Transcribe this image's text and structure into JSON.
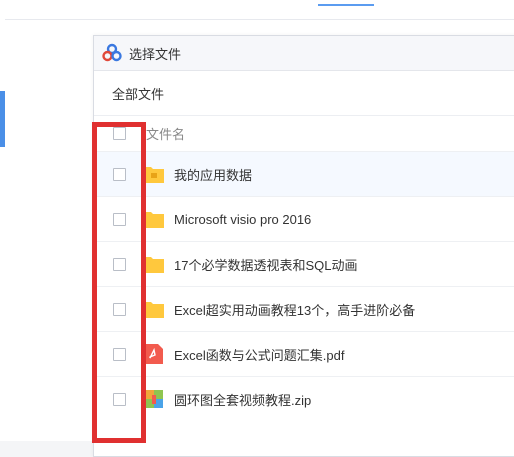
{
  "dialog": {
    "title": "选择文件",
    "breadcrumb": "全部文件",
    "column_name": "文件名"
  },
  "files": [
    {
      "name": "我的应用数据",
      "icon": "folder-app-icon"
    },
    {
      "name": "Microsoft visio pro 2016",
      "icon": "folder-icon"
    },
    {
      "name": "17个必学数据透视表和SQL动画",
      "icon": "folder-icon"
    },
    {
      "name": "Excel超实用动画教程13个，高手进阶必备",
      "icon": "folder-icon"
    },
    {
      "name": "Excel函数与公式问题汇集.pdf",
      "icon": "pdf-icon"
    },
    {
      "name": "圆环图全套视频教程.zip",
      "icon": "zip-icon"
    }
  ],
  "colors": {
    "accent": "#4a8fe7",
    "highlight_border": "#e03030",
    "folder": "#ffc83d",
    "pdf": "#f25b4e"
  }
}
